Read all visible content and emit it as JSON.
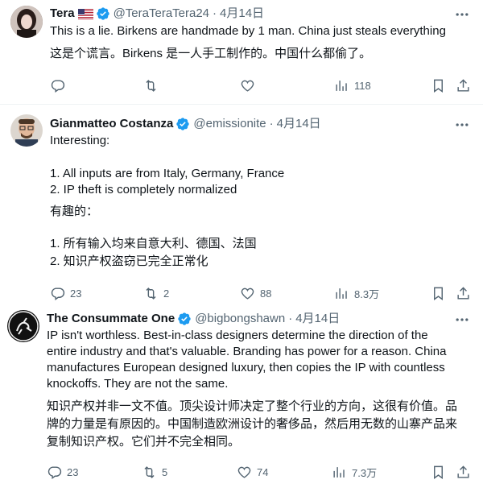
{
  "tweets": [
    {
      "name": "Tera",
      "handle": "@TeraTeraTera24",
      "date": "4月14日",
      "text_lines": [
        "This is a lie. Birkens are handmade by 1 man. China just steals everything",
        "这是个谎言。Birkens 是一人手工制作的。中国什么都偷了。"
      ],
      "replies": "",
      "retweets": "",
      "likes": "",
      "views": "118"
    },
    {
      "name": "Gianmatteo Costanza",
      "handle": "@emissionite",
      "date": "4月14日",
      "text_lines": [
        "Interesting:",
        "1. All inputs are from Italy, Germany, France",
        "2. IP theft is completely normalized",
        "有趣的：",
        "1. 所有输入均来自意大利、德国、法国",
        "2. 知识产权盗窃已完全正常化"
      ],
      "replies": "23",
      "retweets": "2",
      "likes": "88",
      "views": "8.3万"
    },
    {
      "name": "The Consummate One",
      "handle": "@bigbongshawn",
      "date": "4月14日",
      "text_lines": [
        "IP isn't worthless. Best-in-class designers determine the direction of the",
        "entire industry and that's valuable. Branding has power for a reason. China",
        "manufactures European designed luxury, then copies the IP with countless",
        "knockoffs. They are not the same.",
        "知识产权并非一文不值。顶尖设计师决定了整个行业的方向，这很有价值。品",
        "牌的力量是有原因的。中国制造欧洲设计的奢侈品，然后用无数的山寨产品来",
        "复制知识产权。它们并不完全相同。"
      ],
      "replies": "23",
      "retweets": "5",
      "likes": "74",
      "views": "7.3万"
    }
  ],
  "colors": {
    "verified": "#1d9bf0",
    "secondary_text": "#536471",
    "primary_text": "#0f1419",
    "divider": "#eff3f4"
  },
  "icons": [
    "reply-icon",
    "retweet-icon",
    "like-icon",
    "views-icon",
    "bookmark-icon",
    "share-icon",
    "more-icon",
    "verified-badge-icon",
    "us-flag-icon"
  ]
}
